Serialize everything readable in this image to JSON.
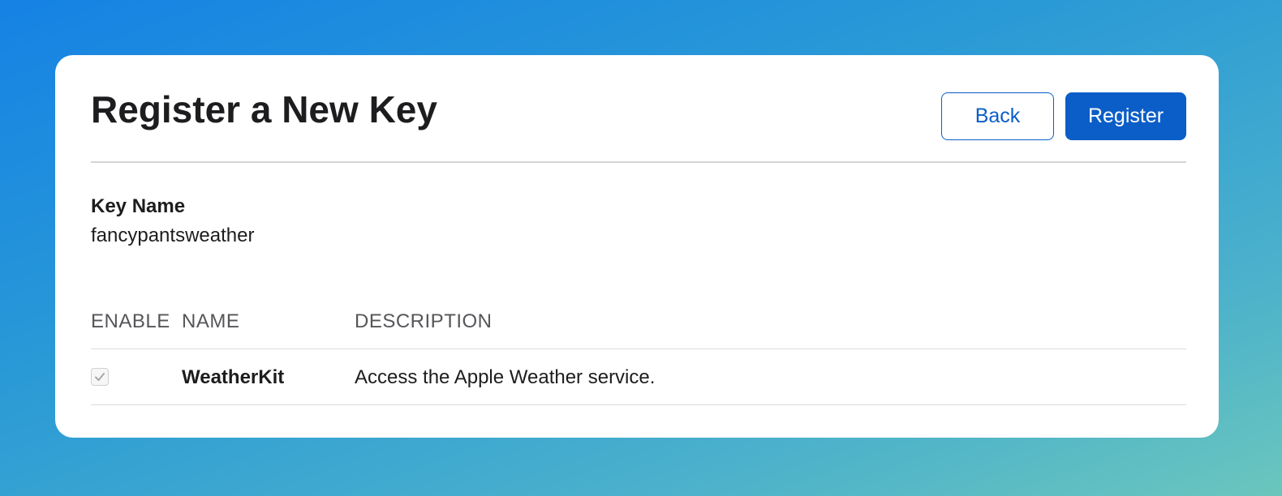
{
  "page": {
    "title": "Register a New Key"
  },
  "actions": {
    "back_label": "Back",
    "register_label": "Register"
  },
  "key_field": {
    "label": "Key Name",
    "value": "fancypantsweather"
  },
  "services_table": {
    "columns": [
      "ENABLE",
      "NAME",
      "DESCRIPTION"
    ],
    "rows": [
      {
        "enabled": true,
        "name": "WeatherKit",
        "description": "Access the Apple Weather service."
      }
    ]
  },
  "colors": {
    "accent": "#0b5ec7",
    "text": "#1d1d1f",
    "muted": "#56565a"
  },
  "icons": {
    "checkbox_mark": "checkmark-icon"
  }
}
